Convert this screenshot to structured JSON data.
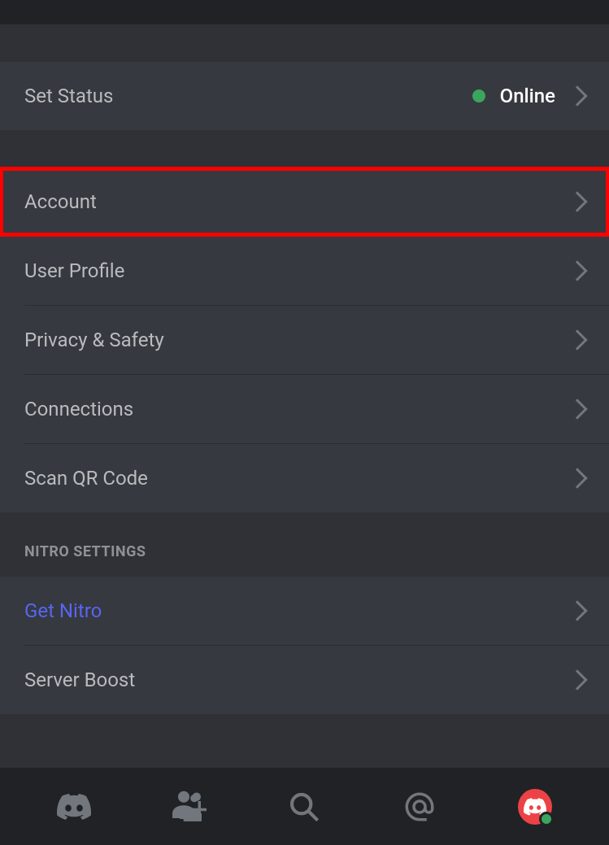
{
  "status": {
    "label": "Set Status",
    "value": "Online"
  },
  "user_settings": {
    "items": [
      {
        "label": "Account",
        "highlighted": true
      },
      {
        "label": "User Profile"
      },
      {
        "label": "Privacy & Safety"
      },
      {
        "label": "Connections"
      },
      {
        "label": "Scan QR Code"
      }
    ]
  },
  "nitro_section": {
    "header": "NITRO SETTINGS",
    "items": [
      {
        "label": "Get Nitro",
        "accent": true
      },
      {
        "label": "Server Boost"
      }
    ]
  }
}
